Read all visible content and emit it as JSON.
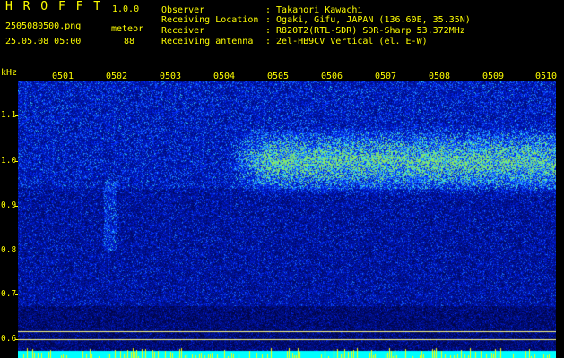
{
  "app": {
    "title": "H R O F F T",
    "version": "1.0.0",
    "filename": "2505080500.png",
    "datetime": "25.05.08 05:00",
    "mode_label": "meteor",
    "count": "88"
  },
  "info": {
    "observer_label": "Observer",
    "observer_value": ": Takanori Kawachi",
    "location_label": "Receiving Location",
    "location_value": ": Ogaki, Gifu, JAPAN (136.60E, 35.35N)",
    "receiver_label": "Receiver",
    "receiver_value": ": R820T2(RTL-SDR) SDR-Sharp 53.372MHz",
    "antenna_label": "Receiving antenna",
    "antenna_value": ": 2el-HB9CV Vertical (el. E-W)"
  },
  "axes": {
    "y_unit": "kHz",
    "y_ticks": [
      "1.1",
      "1.0",
      "0.9",
      "0.8",
      "0.7",
      "0.6"
    ],
    "x_ticks": [
      "0501",
      "0502",
      "0503",
      "0504",
      "0505",
      "0506",
      "0507",
      "0508",
      "0509",
      "0510"
    ]
  },
  "colors": {
    "label": "#ffff00",
    "background": "#000000",
    "noise_dark": "#000060",
    "noise_mid": "#1a2cff",
    "noise_bright": "#3fe08a",
    "strip": "#00ffff"
  }
}
